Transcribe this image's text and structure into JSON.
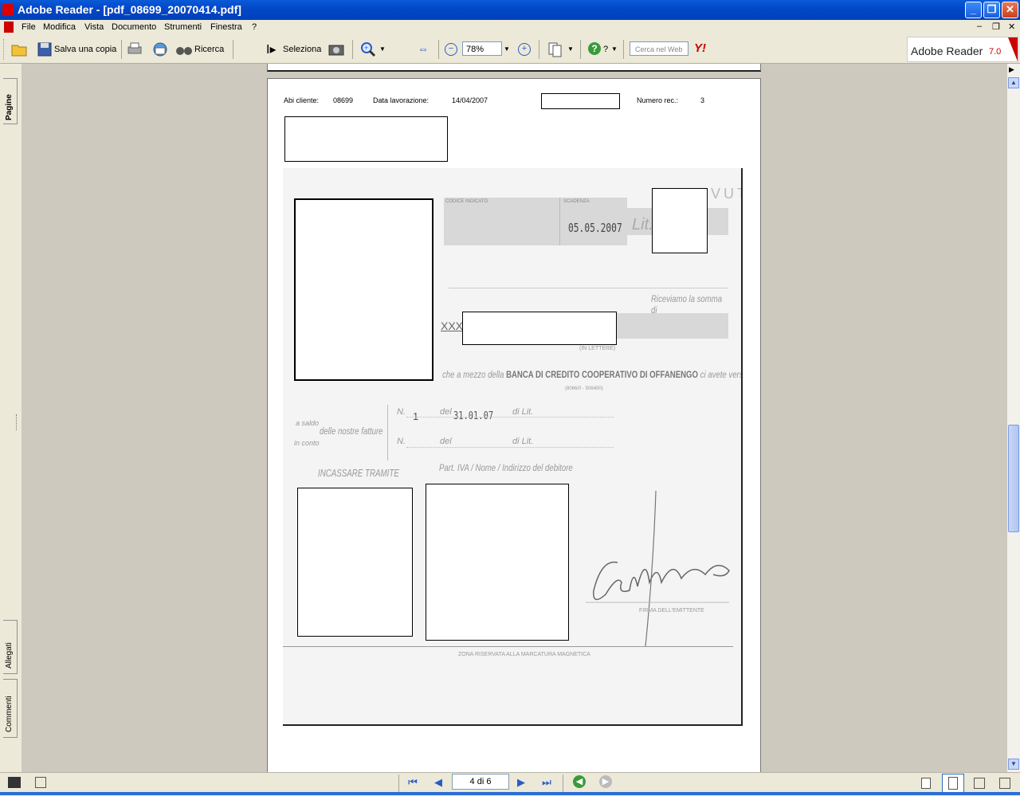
{
  "window": {
    "title": "Adobe Reader - [pdf_08699_20070414.pdf]",
    "minimize_icon": "minimize-icon",
    "restore_icon": "restore-icon",
    "close_icon": "close-icon"
  },
  "menu": {
    "items": [
      "File",
      "Modifica",
      "Vista",
      "Documento",
      "Strumenti",
      "Finestra",
      "?"
    ]
  },
  "toolbar": {
    "save_copy_label": "Salva una copia",
    "search_label": "Ricerca",
    "select_label": "Seleziona",
    "zoom_value": "78%",
    "help_label": "?",
    "web_search_placeholder": "Cerca nel Web",
    "brand_name": "Adobe Reader",
    "brand_version": "7.0"
  },
  "side_tabs": {
    "pages": "Pagine",
    "attachments": "Allegati",
    "comments": "Commenti"
  },
  "document": {
    "header": {
      "abi_label": "Abi cliente:",
      "abi_value": "08699",
      "date_label": "Data lavorazione:",
      "date_value": "14/04/2007",
      "rec_label": "Numero rec.:",
      "rec_value": "3"
    },
    "scan": {
      "code_label": "CODICE INDICATO",
      "due_label": "SCADENZA",
      "due_date": "05.05.2007",
      "currency": "Lit.",
      "ricevuta": "RICEVUTA",
      "received_sum": "Riceviamo la somma di",
      "xxx": "XXX",
      "lit_short": "Lit.",
      "in_letters": "(IN LETTERE)",
      "bank_line_pre": "che a mezzo della",
      "bank_name": "BANCA DI CREDITO COOPERATIVO DI OFFANENGO",
      "bank_line_post": "ci avete versata",
      "bank_code": "(8066/0 - 506400)",
      "a_saldo": "a saldo",
      "in_conto": "in conto",
      "delle_fatture": "delle nostre fatture",
      "n_label": "N.",
      "n_value": "1",
      "del_label": "del",
      "del_value": "31.01.07",
      "di_lit": "di Lit.",
      "piva": "Part. IVA / Nome / Indirizzo del debitore",
      "incassare": "INCASSARE TRAMITE",
      "firma": "FIRMA DELL'EMITTENTE",
      "zona": "ZONA RISERVATA ALLA MARCATURA MAGNETICA"
    }
  },
  "status": {
    "page_indicator": "4 di 6"
  },
  "colors": {
    "titlebar": "#0348c8",
    "chrome": "#ece9d8",
    "workspace": "#cdc9bf"
  }
}
